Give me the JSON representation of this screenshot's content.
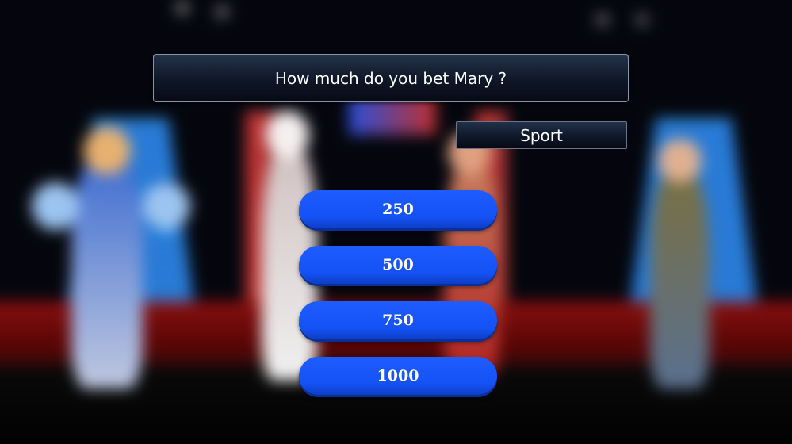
{
  "question": {
    "text": "How much do you bet Mary ?"
  },
  "category": {
    "label": "Sport"
  },
  "bets": [
    {
      "label": "250"
    },
    {
      "label": "500"
    },
    {
      "label": "750"
    },
    {
      "label": "1000"
    }
  ],
  "colors": {
    "bet_button": "#1e5cff",
    "panel": "#0f1727",
    "text": "#ffffff"
  }
}
